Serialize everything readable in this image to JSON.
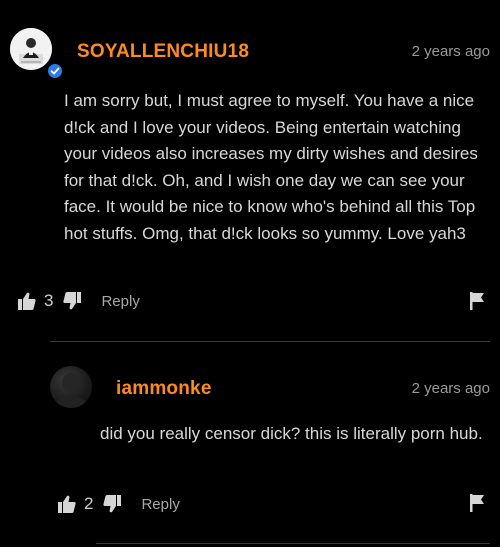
{
  "colors": {
    "background": "#000000",
    "username": "#ff8a1f",
    "text": "#d8d8d8",
    "muted": "#9a9a9a",
    "verified": "#2e7ae6"
  },
  "comments": [
    {
      "username": "SOYALLENCHIU18",
      "timestamp": "2 years ago",
      "verified": true,
      "avatar_icon": "user-photo-avatar",
      "text": "I am sorry but, I must agree to myself. You have a nice d!ck and I love your videos. Being entertain watching your videos also increases my dirty wishes and desires for that d!ck. Oh, and I wish one day we can see your face. It would be nice to know who's behind all this Top hot stuffs. Omg, that d!ck looks so yummy. Love yah3",
      "likes": "3",
      "reply_label": "Reply",
      "icons": {
        "like": "thumbs-up-icon",
        "dislike": "thumbs-down-icon",
        "flag": "flag-icon"
      }
    },
    {
      "username": "iammonke",
      "timestamp": "2 years ago",
      "verified": false,
      "avatar_icon": "dark-avatar",
      "text": "did you really censor dick? this is literally porn hub.",
      "likes": "2",
      "reply_label": "Reply",
      "icons": {
        "like": "thumbs-up-icon",
        "dislike": "thumbs-down-icon",
        "flag": "flag-icon"
      }
    }
  ]
}
